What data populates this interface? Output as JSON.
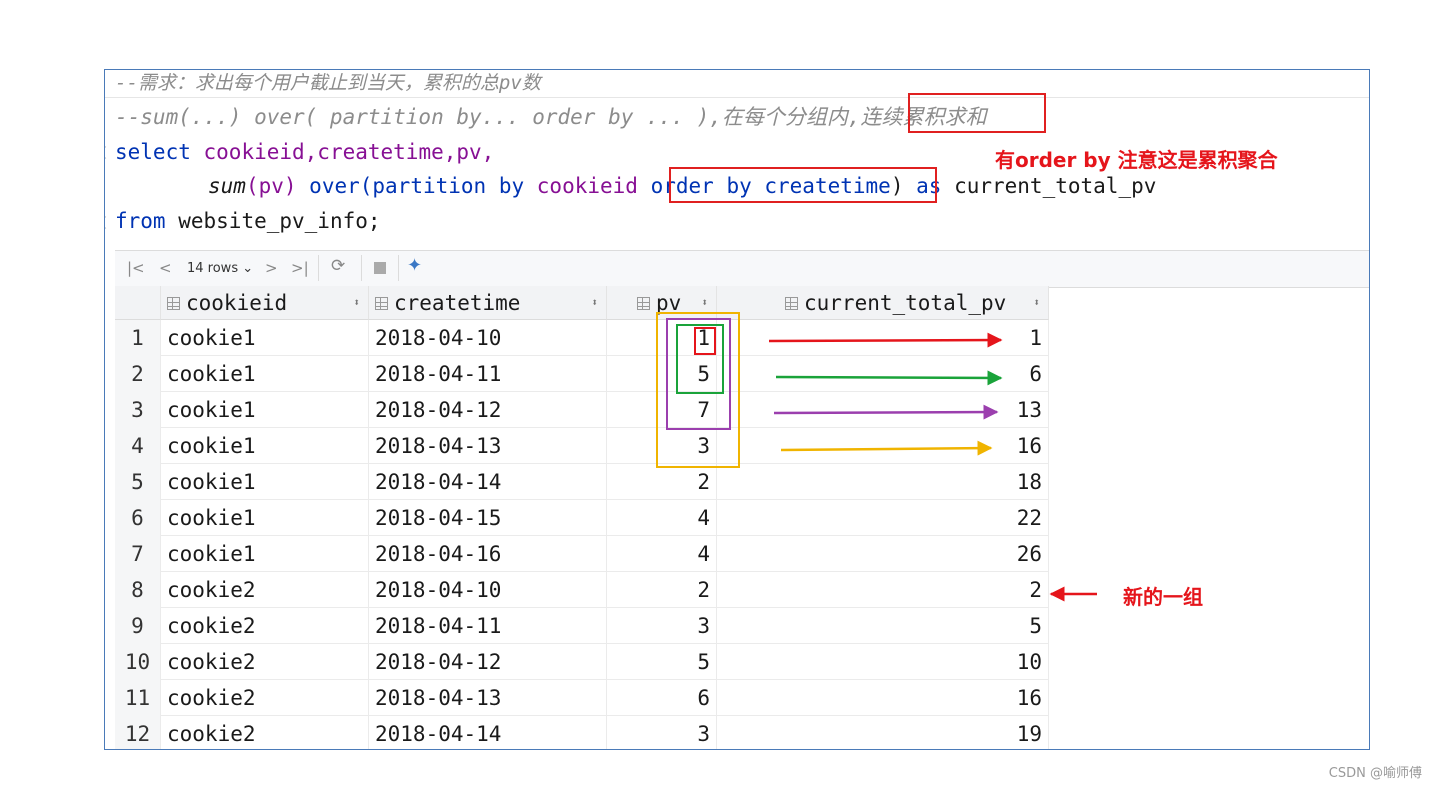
{
  "code": {
    "comment1": "--需求：求出每个用户截止到当天，累积的总pv数",
    "comment2_prefix": "--sum(...) over( partition by... order by ... ),在每个分组内,",
    "comment2_highlight": "连续累积求和",
    "line3": {
      "kw_select": "select",
      "cols": "cookieid,createtime,pv,"
    },
    "line4": {
      "fn": "sum",
      "arg": "(pv)",
      "kw_over": "over",
      "kw_partition": "(partition by",
      "col": "cookieid",
      "order_clause": "order by createtime",
      "close": ")",
      "kw_as": "as",
      "alias": "current_total_pv"
    },
    "line5": {
      "kw_from": "from",
      "table": "website_pv_info;"
    }
  },
  "annotations": {
    "order_note": "有order by 注意这是累积聚合",
    "new_group": "新的一组"
  },
  "toolbar": {
    "rows_label": "14 rows"
  },
  "columns": [
    "cookieid",
    "createtime",
    "pv",
    "current_total_pv"
  ],
  "rows": [
    {
      "n": "1",
      "cookieid": "cookie1",
      "createtime": "2018-04-10",
      "pv": "1",
      "total": "1"
    },
    {
      "n": "2",
      "cookieid": "cookie1",
      "createtime": "2018-04-11",
      "pv": "5",
      "total": "6"
    },
    {
      "n": "3",
      "cookieid": "cookie1",
      "createtime": "2018-04-12",
      "pv": "7",
      "total": "13"
    },
    {
      "n": "4",
      "cookieid": "cookie1",
      "createtime": "2018-04-13",
      "pv": "3",
      "total": "16"
    },
    {
      "n": "5",
      "cookieid": "cookie1",
      "createtime": "2018-04-14",
      "pv": "2",
      "total": "18"
    },
    {
      "n": "6",
      "cookieid": "cookie1",
      "createtime": "2018-04-15",
      "pv": "4",
      "total": "22"
    },
    {
      "n": "7",
      "cookieid": "cookie1",
      "createtime": "2018-04-16",
      "pv": "4",
      "total": "26"
    },
    {
      "n": "8",
      "cookieid": "cookie2",
      "createtime": "2018-04-10",
      "pv": "2",
      "total": "2"
    },
    {
      "n": "9",
      "cookieid": "cookie2",
      "createtime": "2018-04-11",
      "pv": "3",
      "total": "5"
    },
    {
      "n": "10",
      "cookieid": "cookie2",
      "createtime": "2018-04-12",
      "pv": "5",
      "total": "10"
    },
    {
      "n": "11",
      "cookieid": "cookie2",
      "createtime": "2018-04-13",
      "pv": "6",
      "total": "16"
    },
    {
      "n": "12",
      "cookieid": "cookie2",
      "createtime": "2018-04-14",
      "pv": "3",
      "total": "19"
    }
  ],
  "colors": {
    "red": "#e5151b",
    "green": "#1aa33a",
    "purple": "#9b3fae",
    "orange": "#f0b400"
  },
  "watermark": "CSDN @喻师傅"
}
